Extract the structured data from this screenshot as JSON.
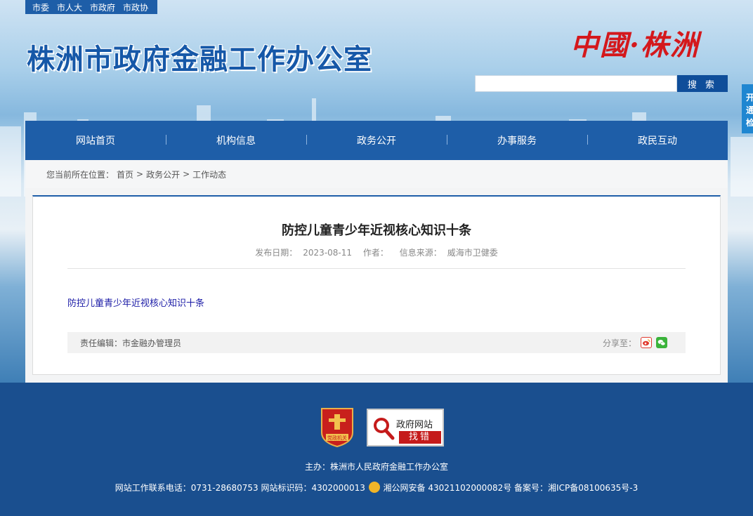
{
  "topbar": {
    "links": [
      "市委",
      "市人大",
      "市政府",
      "市政协"
    ]
  },
  "header": {
    "site_title": "株洲市政府金融工作办公室",
    "logo_text": "中國·株洲",
    "search_placeholder": "",
    "search_label": "搜 索",
    "side_tab": "开通检"
  },
  "nav": {
    "items": [
      "网站首页",
      "机构信息",
      "政务公开",
      "办事服务",
      "政民互动"
    ]
  },
  "breadcrumb": {
    "prefix": "您当前所在位置：",
    "items": [
      "首页",
      ">",
      "政务公开",
      ">",
      "工作动态"
    ]
  },
  "article": {
    "title": "防控儿童青少年近视核心知识十条",
    "meta": {
      "date_label": "发布日期：",
      "date": "2023-08-11",
      "author_label": "作者：",
      "source_label": "信息来源：",
      "source": "威海市卫健委"
    },
    "link_text": "防控儿童青少年近视核心知识十条",
    "editor": "责任编辑：市金融办管理员",
    "share_label": "分享至："
  },
  "footer": {
    "badge_text": "党政机关",
    "find_error_title": "政府网站",
    "find_error_action": "找错",
    "sponsor": "主办：株洲市人民政府金融工作办公室",
    "contact_prefix": "网站工作联系电话：0731-28680753 网站标识码：4302000013",
    "police_record": "湘公网安备 43021102000082号",
    "icp": "备案号：湘ICP备08100635号-3"
  },
  "colors": {
    "primary": "#1e5ea8",
    "footer": "#1a4f8f",
    "accent_red": "#c51b1b"
  }
}
